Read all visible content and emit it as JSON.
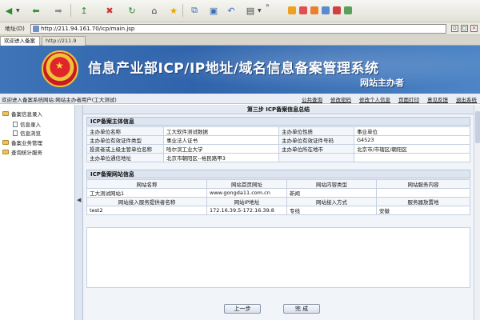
{
  "browser": {
    "address_label": "地址(D)",
    "url": "http://211.94.161.70/icp/main.jsp",
    "tabs": [
      "欢迎进入备案",
      "http://211.9"
    ]
  },
  "banner": {
    "title": "信息产业部ICP/IP地址/域名信息备案管理系统",
    "subtitle": "网站主办者"
  },
  "infostrip": {
    "welcome": "欢迎进入备案系统网站:网站主办者用户(工大测试)",
    "links": [
      "公共查询",
      "修改密码",
      "修改个人信息",
      "页面打印",
      "意见反馈",
      "退出系统"
    ]
  },
  "sidebar": {
    "items": [
      {
        "label": "备案信息录入",
        "level": 0
      },
      {
        "label": "信息录入",
        "level": 1
      },
      {
        "label": "信息浏览",
        "level": 1
      },
      {
        "label": "备案业务管理",
        "level": 0
      },
      {
        "label": "查询统计服务",
        "level": 0
      }
    ]
  },
  "content": {
    "step_title": "第三步 ICP备案信息总结",
    "section_subject": "ICP备案主体信息",
    "subject_rows": [
      [
        "主办单位名称",
        "工大软件测试数据",
        "主办单位性质",
        "事业单位"
      ],
      [
        "主办单位有效证件类型",
        "事业法人证书",
        "主办单位有效证件号码",
        "G4523"
      ],
      [
        "投资者或上级主管单位名称",
        "哈尔滨工业大学",
        "主办单位所在地市",
        "北京市/市辖区/朝阳区"
      ],
      [
        "主办单位通信地址",
        "北京市朝阳区--裕民路甲3",
        "",
        ""
      ]
    ],
    "section_web": "ICP备案网站信息",
    "web_header": [
      "网站名称",
      "网站首页网址",
      "网站内容类型",
      "网站服务内容"
    ],
    "web_row": [
      "工大测试网站1",
      "www.gongda11.com.cn",
      "新闻",
      ""
    ],
    "access_header": [
      "网站接入服务提供者名称",
      "网站IP地址",
      "网站接入方式",
      "服务器放置地"
    ],
    "access_row": [
      "test2",
      "172.16.39.5-172.16.39.8",
      "专线",
      "安徽"
    ],
    "btn_prev": "上一步",
    "btn_done": "完 成"
  }
}
